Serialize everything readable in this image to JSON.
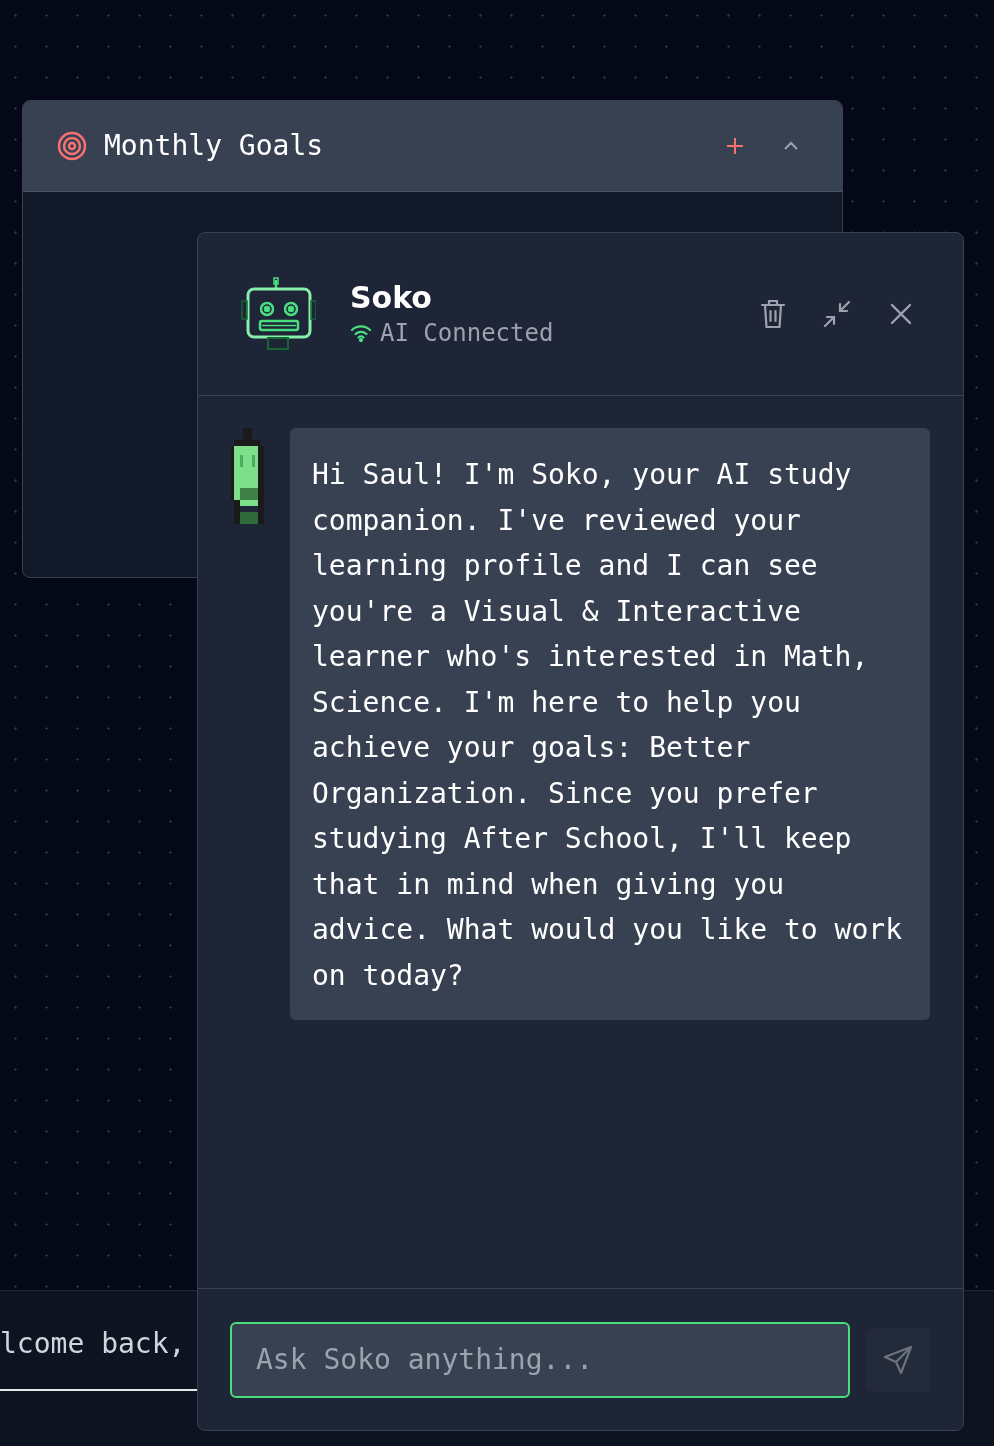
{
  "goals_card": {
    "title": "Monthly Goals"
  },
  "background_page": {
    "greeting": "lcome back,"
  },
  "chat": {
    "name": "Soko",
    "status": "AI Connected",
    "connected": true,
    "messages": [
      {
        "kind": "assistant",
        "text": "Hi Saul! I'm Soko, your AI study companion. I've reviewed your learning profile and I can see you're a Visual & Interactive learner who's interested in Math, Science. I'm here to help you achieve your goals: Better Organization. Since you prefer studying After School, I'll keep that in mind when giving you advice. What would you like to work on today?"
      }
    ],
    "input": {
      "placeholder": "Ask Soko anything..."
    }
  }
}
